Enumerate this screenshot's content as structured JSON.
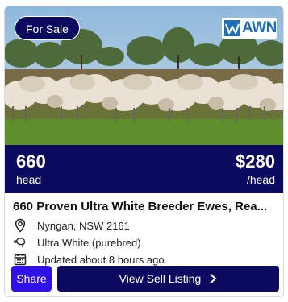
{
  "listing": {
    "badge": "For Sale",
    "logo_text": "AWN",
    "quantity": "660",
    "quantity_unit": "head",
    "price": "$280",
    "price_unit": "/head",
    "title": "660 Proven Ultra White Breeder Ewes, Rea...",
    "location": "Nyngan, NSW 2161",
    "breed": "Ultra White (purebred)",
    "updated": "Updated about 8 hours ago"
  },
  "actions": {
    "share_label": "Share",
    "view_label": "View Sell Listing"
  },
  "icons": {
    "location": "map-pin-icon",
    "breed": "sheep-icon",
    "updated": "calendar-icon",
    "chevron": "chevron-right-icon"
  },
  "colors": {
    "navy": "#0c0a5e",
    "share_blue": "#2f10e6",
    "logo_blue": "#1f6fb8"
  }
}
